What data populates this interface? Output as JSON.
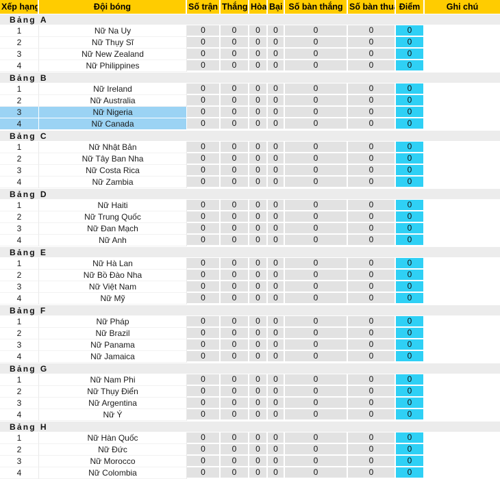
{
  "table": {
    "columns": [
      {
        "key": "rank",
        "label": "Xếp hạng"
      },
      {
        "key": "team",
        "label": "Đội bóng"
      },
      {
        "key": "played",
        "label": "Số trận"
      },
      {
        "key": "win",
        "label": "Thắng"
      },
      {
        "key": "draw",
        "label": "Hòa"
      },
      {
        "key": "loss",
        "label": "Bại"
      },
      {
        "key": "gf",
        "label": "Số bàn thắng"
      },
      {
        "key": "ga",
        "label": "Số bàn thua"
      },
      {
        "key": "points",
        "label": "Điểm"
      },
      {
        "key": "note",
        "label": "Ghi chú"
      }
    ],
    "group_prefix": "Bảng",
    "colors": {
      "header_background": "#ffcc00",
      "group_band": "#ececec",
      "stat_cell": "#e2e2e2",
      "points_cell": "#2fd0f5",
      "selected_row": "#9bd3f4",
      "page_background": "#ffffff"
    },
    "groups": [
      {
        "letter": "A",
        "rows": [
          {
            "rank": "1",
            "team": "Nữ Na Uy",
            "played": "0",
            "win": "0",
            "draw": "0",
            "loss": "0",
            "gf": "0",
            "ga": "0",
            "points": "0",
            "note": "",
            "selected": false
          },
          {
            "rank": "2",
            "team": "Nữ Thụy Sĩ",
            "played": "0",
            "win": "0",
            "draw": "0",
            "loss": "0",
            "gf": "0",
            "ga": "0",
            "points": "0",
            "note": "",
            "selected": false
          },
          {
            "rank": "3",
            "team": "Nữ New Zealand",
            "played": "0",
            "win": "0",
            "draw": "0",
            "loss": "0",
            "gf": "0",
            "ga": "0",
            "points": "0",
            "note": "",
            "selected": false
          },
          {
            "rank": "4",
            "team": "Nữ Philippines",
            "played": "0",
            "win": "0",
            "draw": "0",
            "loss": "0",
            "gf": "0",
            "ga": "0",
            "points": "0",
            "note": "",
            "selected": false
          }
        ]
      },
      {
        "letter": "B",
        "rows": [
          {
            "rank": "1",
            "team": "Nữ Ireland",
            "played": "0",
            "win": "0",
            "draw": "0",
            "loss": "0",
            "gf": "0",
            "ga": "0",
            "points": "0",
            "note": "",
            "selected": false
          },
          {
            "rank": "2",
            "team": "Nữ Australia",
            "played": "0",
            "win": "0",
            "draw": "0",
            "loss": "0",
            "gf": "0",
            "ga": "0",
            "points": "0",
            "note": "",
            "selected": false
          },
          {
            "rank": "3",
            "team": "Nữ Nigeria",
            "played": "0",
            "win": "0",
            "draw": "0",
            "loss": "0",
            "gf": "0",
            "ga": "0",
            "points": "0",
            "note": "",
            "selected": true
          },
          {
            "rank": "4",
            "team": "Nữ Canada",
            "played": "0",
            "win": "0",
            "draw": "0",
            "loss": "0",
            "gf": "0",
            "ga": "0",
            "points": "0",
            "note": "",
            "selected": true
          }
        ]
      },
      {
        "letter": "C",
        "rows": [
          {
            "rank": "1",
            "team": "Nữ Nhật Bản",
            "played": "0",
            "win": "0",
            "draw": "0",
            "loss": "0",
            "gf": "0",
            "ga": "0",
            "points": "0",
            "note": "",
            "selected": false
          },
          {
            "rank": "2",
            "team": "Nữ Tây Ban Nha",
            "played": "0",
            "win": "0",
            "draw": "0",
            "loss": "0",
            "gf": "0",
            "ga": "0",
            "points": "0",
            "note": "",
            "selected": false
          },
          {
            "rank": "3",
            "team": "Nữ Costa Rica",
            "played": "0",
            "win": "0",
            "draw": "0",
            "loss": "0",
            "gf": "0",
            "ga": "0",
            "points": "0",
            "note": "",
            "selected": false
          },
          {
            "rank": "4",
            "team": "Nữ Zambia",
            "played": "0",
            "win": "0",
            "draw": "0",
            "loss": "0",
            "gf": "0",
            "ga": "0",
            "points": "0",
            "note": "",
            "selected": false
          }
        ]
      },
      {
        "letter": "D",
        "rows": [
          {
            "rank": "1",
            "team": "Nữ Haiti",
            "played": "0",
            "win": "0",
            "draw": "0",
            "loss": "0",
            "gf": "0",
            "ga": "0",
            "points": "0",
            "note": "",
            "selected": false
          },
          {
            "rank": "2",
            "team": "Nữ Trung Quốc",
            "played": "0",
            "win": "0",
            "draw": "0",
            "loss": "0",
            "gf": "0",
            "ga": "0",
            "points": "0",
            "note": "",
            "selected": false
          },
          {
            "rank": "3",
            "team": "Nữ Đan Mạch",
            "played": "0",
            "win": "0",
            "draw": "0",
            "loss": "0",
            "gf": "0",
            "ga": "0",
            "points": "0",
            "note": "",
            "selected": false
          },
          {
            "rank": "4",
            "team": "Nữ Anh",
            "played": "0",
            "win": "0",
            "draw": "0",
            "loss": "0",
            "gf": "0",
            "ga": "0",
            "points": "0",
            "note": "",
            "selected": false
          }
        ]
      },
      {
        "letter": "E",
        "rows": [
          {
            "rank": "1",
            "team": "Nữ Hà Lan",
            "played": "0",
            "win": "0",
            "draw": "0",
            "loss": "0",
            "gf": "0",
            "ga": "0",
            "points": "0",
            "note": "",
            "selected": false
          },
          {
            "rank": "2",
            "team": "Nữ Bồ Đào Nha",
            "played": "0",
            "win": "0",
            "draw": "0",
            "loss": "0",
            "gf": "0",
            "ga": "0",
            "points": "0",
            "note": "",
            "selected": false
          },
          {
            "rank": "3",
            "team": "Nữ Việt Nam",
            "played": "0",
            "win": "0",
            "draw": "0",
            "loss": "0",
            "gf": "0",
            "ga": "0",
            "points": "0",
            "note": "",
            "selected": false
          },
          {
            "rank": "4",
            "team": "Nữ Mỹ",
            "played": "0",
            "win": "0",
            "draw": "0",
            "loss": "0",
            "gf": "0",
            "ga": "0",
            "points": "0",
            "note": "",
            "selected": false
          }
        ]
      },
      {
        "letter": "F",
        "rows": [
          {
            "rank": "1",
            "team": "Nữ Pháp",
            "played": "0",
            "win": "0",
            "draw": "0",
            "loss": "0",
            "gf": "0",
            "ga": "0",
            "points": "0",
            "note": "",
            "selected": false
          },
          {
            "rank": "2",
            "team": "Nữ Brazil",
            "played": "0",
            "win": "0",
            "draw": "0",
            "loss": "0",
            "gf": "0",
            "ga": "0",
            "points": "0",
            "note": "",
            "selected": false
          },
          {
            "rank": "3",
            "team": "Nữ Panama",
            "played": "0",
            "win": "0",
            "draw": "0",
            "loss": "0",
            "gf": "0",
            "ga": "0",
            "points": "0",
            "note": "",
            "selected": false
          },
          {
            "rank": "4",
            "team": "Nữ Jamaica",
            "played": "0",
            "win": "0",
            "draw": "0",
            "loss": "0",
            "gf": "0",
            "ga": "0",
            "points": "0",
            "note": "",
            "selected": false
          }
        ]
      },
      {
        "letter": "G",
        "rows": [
          {
            "rank": "1",
            "team": "Nữ Nam Phi",
            "played": "0",
            "win": "0",
            "draw": "0",
            "loss": "0",
            "gf": "0",
            "ga": "0",
            "points": "0",
            "note": "",
            "selected": false
          },
          {
            "rank": "2",
            "team": "Nữ Thụy Điển",
            "played": "0",
            "win": "0",
            "draw": "0",
            "loss": "0",
            "gf": "0",
            "ga": "0",
            "points": "0",
            "note": "",
            "selected": false
          },
          {
            "rank": "3",
            "team": "Nữ Argentina",
            "played": "0",
            "win": "0",
            "draw": "0",
            "loss": "0",
            "gf": "0",
            "ga": "0",
            "points": "0",
            "note": "",
            "selected": false
          },
          {
            "rank": "4",
            "team": "Nữ Ý",
            "played": "0",
            "win": "0",
            "draw": "0",
            "loss": "0",
            "gf": "0",
            "ga": "0",
            "points": "0",
            "note": "",
            "selected": false
          }
        ]
      },
      {
        "letter": "H",
        "rows": [
          {
            "rank": "1",
            "team": "Nữ Hàn Quốc",
            "played": "0",
            "win": "0",
            "draw": "0",
            "loss": "0",
            "gf": "0",
            "ga": "0",
            "points": "0",
            "note": "",
            "selected": false
          },
          {
            "rank": "2",
            "team": "Nữ Đức",
            "played": "0",
            "win": "0",
            "draw": "0",
            "loss": "0",
            "gf": "0",
            "ga": "0",
            "points": "0",
            "note": "",
            "selected": false
          },
          {
            "rank": "3",
            "team": "Nữ Morocco",
            "played": "0",
            "win": "0",
            "draw": "0",
            "loss": "0",
            "gf": "0",
            "ga": "0",
            "points": "0",
            "note": "",
            "selected": false
          },
          {
            "rank": "4",
            "team": "Nữ Colombia",
            "played": "0",
            "win": "0",
            "draw": "0",
            "loss": "0",
            "gf": "0",
            "ga": "0",
            "points": "0",
            "note": "",
            "selected": false
          }
        ]
      }
    ]
  }
}
